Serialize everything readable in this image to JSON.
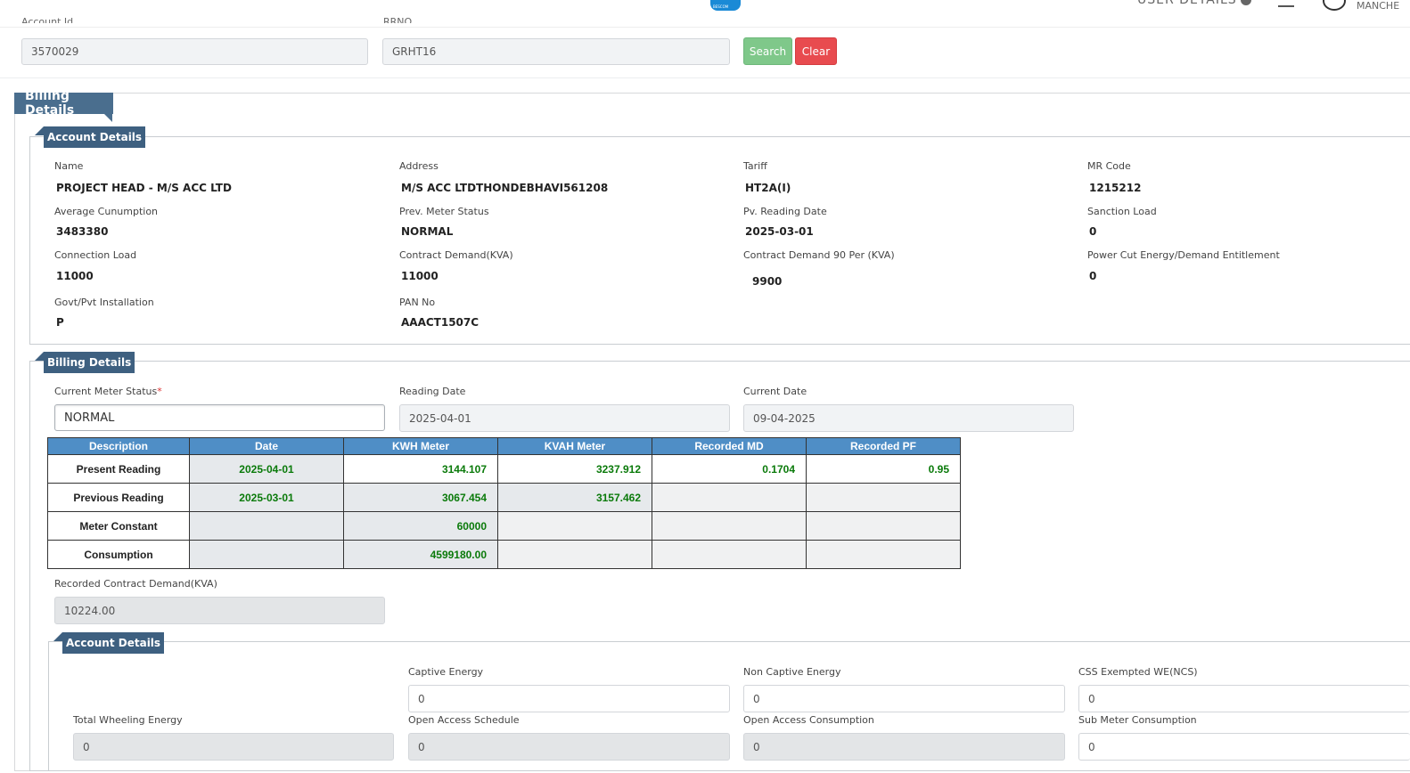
{
  "header": {
    "logo_text": "BESCOM",
    "user_details_label": "USER DETAILS",
    "user_name_partial": "MANCHE"
  },
  "search": {
    "account_id_label": "Account Id",
    "account_id_value": "3570029",
    "rrno_label": "RRNO",
    "rrno_value": "GRHT16",
    "search_label": "Search",
    "clear_label": "Clear"
  },
  "billing_tab_label": "Billing Details",
  "account_details": {
    "legend": "Account Details",
    "fields": [
      {
        "label": "Name",
        "value": "PROJECT HEAD - M/S ACC LTD"
      },
      {
        "label": "Address",
        "value": "M/S ACC LTDTHONDEBHAVI561208"
      },
      {
        "label": "Tariff",
        "value": "HT2A(I)"
      },
      {
        "label": "MR Code",
        "value": "1215212"
      },
      {
        "label": "Average Cunumption",
        "value": "3483380"
      },
      {
        "label": "Prev. Meter Status",
        "value": "NORMAL"
      },
      {
        "label": "Pv. Reading Date",
        "value": "2025-03-01"
      },
      {
        "label": "Sanction Load",
        "value": "0"
      },
      {
        "label": "Connection Load",
        "value": "11000"
      },
      {
        "label": "Contract Demand(KVA)",
        "value": "11000"
      },
      {
        "label": "Contract Demand 90 Per (KVA)",
        "value": "9900"
      },
      {
        "label": "Power Cut Energy/Demand Entitlement",
        "value": "0"
      },
      {
        "label": "Govt/Pvt Installation",
        "value": "P"
      },
      {
        "label": "PAN No",
        "value": "AAACT1507C"
      }
    ]
  },
  "billing_details": {
    "legend": "Billing Details",
    "current_meter_status_label": "Current Meter Status",
    "required_mark": "*",
    "current_meter_status_value": "NORMAL",
    "reading_date_label": "Reading Date",
    "reading_date_value": "2025-04-01",
    "current_date_label": "Current Date",
    "current_date_value": "09-04-2025",
    "table": {
      "headers": [
        "Description",
        "Date",
        "KWH Meter",
        "KVAH Meter",
        "Recorded MD",
        "Recorded PF"
      ],
      "rows": [
        [
          "Present Reading",
          "2025-04-01",
          "3144.107",
          "3237.912",
          "0.1704",
          "0.95"
        ],
        [
          "Previous Reading",
          "2025-03-01",
          "3067.454",
          "3157.462",
          "",
          ""
        ],
        [
          "Meter Constant",
          "",
          "60000",
          "",
          "",
          ""
        ],
        [
          "Consumption",
          "",
          "4599180.00",
          "",
          "",
          ""
        ]
      ]
    },
    "recorded_cd_label": "Recorded Contract Demand(KVA)",
    "recorded_cd_value": "10224.00"
  },
  "energy_details": {
    "legend": "Account Details",
    "captive_energy_label": "Captive Energy",
    "captive_energy_value": "0",
    "non_captive_energy_label": "Non Captive Energy",
    "non_captive_energy_value": "0",
    "css_exempted_label": "CSS Exempted WE(NCS)",
    "css_exempted_value": "0",
    "total_wheeling_label": "Total Wheeling Energy",
    "total_wheeling_value": "0",
    "oa_schedule_label": "Open Access Schedule",
    "oa_schedule_value": "0",
    "oa_consumption_label": "Open Access Consumption",
    "oa_consumption_value": "0",
    "sub_meter_label": "Sub Meter Consumption",
    "sub_meter_value": "0"
  }
}
